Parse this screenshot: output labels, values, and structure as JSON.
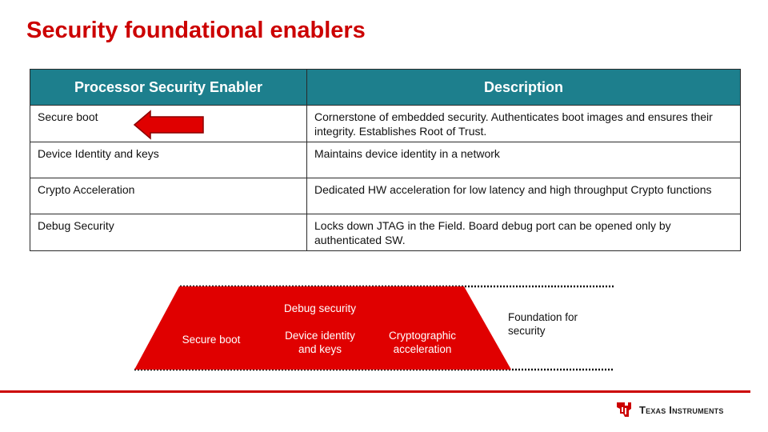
{
  "slide": {
    "title": "Security foundational enablers"
  },
  "table": {
    "headers": [
      "Processor Security Enabler",
      "Description"
    ],
    "rows": [
      {
        "enabler": "Secure boot",
        "description": "Cornerstone of embedded security. Authenticates boot images and ensures their integrity.  Establishes Root of Trust."
      },
      {
        "enabler": "Device Identity and keys",
        "description": "Maintains device identity in a network"
      },
      {
        "enabler": "Crypto Acceleration",
        "description": "Dedicated HW acceleration for low latency and high throughput Crypto functions"
      },
      {
        "enabler": "Debug Security",
        "description": "Locks down JTAG in the Field. Board debug port can be opened only by authenticated SW."
      }
    ]
  },
  "pyramid": {
    "top": "Debug security",
    "left": "Secure boot",
    "middle": "Device identity and keys",
    "right": "Cryptographic acceleration",
    "side_label": "Foundation for security"
  },
  "logo": {
    "text": "Texas Instruments"
  },
  "colors": {
    "accent_red": "#cc0000",
    "header_teal": "#1d7f8d",
    "arrow_red": "#e00000",
    "pyramid_red": "#e00000"
  }
}
